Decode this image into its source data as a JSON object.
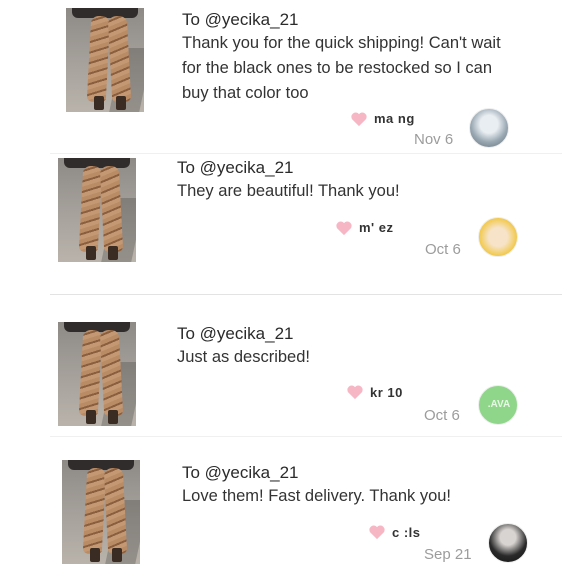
{
  "reviews": [
    {
      "to": "To @yecika_21",
      "message": "Thank you for the quick shipping! Can't wait for the black ones to be restocked so I can buy that color too",
      "username": "ma        ng",
      "date": "Nov 6",
      "avatar_icon": "user-avatar-photo"
    },
    {
      "to": "To @yecika_21",
      "message": "They are beautiful! Thank you!",
      "username": "m'          ez",
      "date": "Oct 6",
      "avatar_icon": "user-avatar-cartoon"
    },
    {
      "to": "To @yecika_21",
      "message": "Just as described!",
      "username": "kr          10",
      "date": "Oct 6",
      "avatar_icon": "user-avatar-green"
    },
    {
      "to": "To @yecika_21",
      "message": "Love them! Fast delivery. Thank you!",
      "username": "c         :ls",
      "date": "Sep 21",
      "avatar_icon": "user-avatar-dark"
    }
  ],
  "colors": {
    "heart": "#f6b6c4",
    "date": "#9c9c9c",
    "divider": "#e3e3e3"
  }
}
